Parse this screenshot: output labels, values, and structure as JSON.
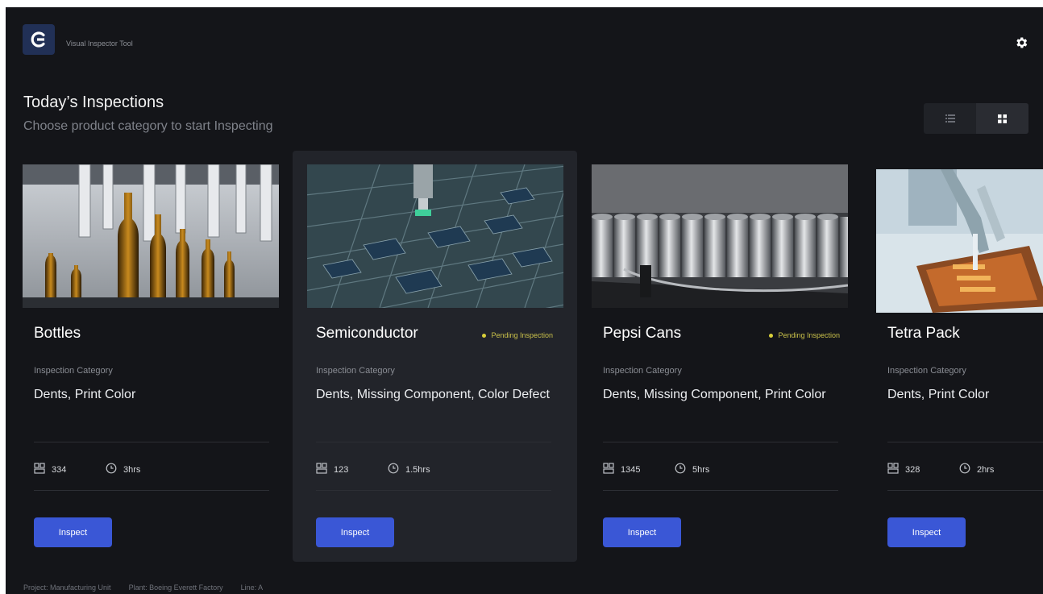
{
  "header": {
    "app_name": "Visual Inspector Tool",
    "logo_icon": "brand-logo-icon",
    "settings_icon": "gear-icon"
  },
  "page": {
    "title": "Today’s Inspections",
    "subtitle": "Choose product category to start Inspecting"
  },
  "view_toggle": {
    "options": [
      "list-view-icon",
      "grid-view-icon"
    ],
    "selected": "grid-view-icon"
  },
  "colors": {
    "background": "#141519",
    "card_highlight": "#22242a",
    "accent": "#3a57d6",
    "pending": "#d8cf3a"
  },
  "cards": [
    {
      "name": "Bottles",
      "status": "",
      "category_label": "Inspection Category",
      "category_value": "Dents, Print Color",
      "count": "334",
      "duration": "3hrs",
      "button_label": "Inspect"
    },
    {
      "name": "Semiconductor",
      "status": "Pending Inspection",
      "category_label": "Inspection Category",
      "category_value": "Dents, Missing Component, Color Defect",
      "count": "123",
      "duration": "1.5hrs",
      "button_label": "Inspect"
    },
    {
      "name": "Pepsi Cans",
      "status": "Pending Inspection",
      "category_label": "Inspection Category",
      "category_value": "Dents, Missing Component, Print Color",
      "count": "1345",
      "duration": "5hrs",
      "button_label": "Inspect"
    },
    {
      "name": "Tetra Pack",
      "status": "",
      "category_label": "Inspection Category",
      "category_value": "Dents, Print Color",
      "count": "328",
      "duration": "2hrs",
      "button_label": "Inspect"
    }
  ],
  "footer": {
    "project": "Project: Manufacturing Unit",
    "plant": "Plant: Boeing Everett Factory",
    "line": "Line: A"
  }
}
